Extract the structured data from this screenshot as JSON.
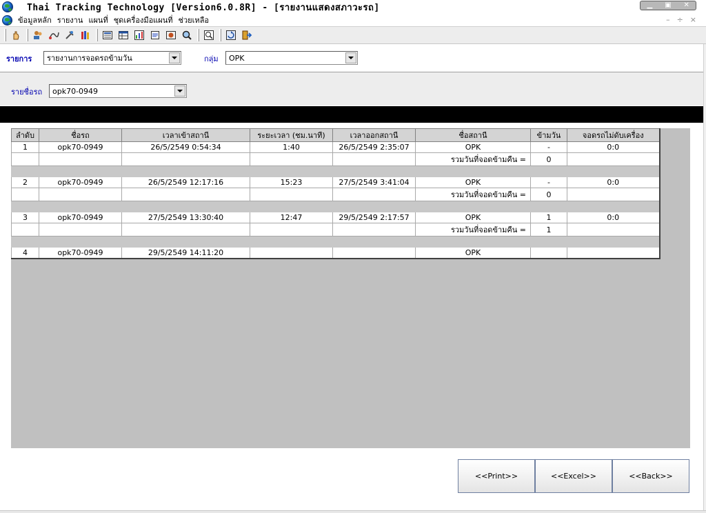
{
  "window": {
    "title": "Thai Tracking Technology [Version6.0.8R] - [รายงานแสดงสภาวะรถ]",
    "controls": [
      "▁",
      "▣",
      "✕"
    ]
  },
  "menu": {
    "items": [
      "ข้อมูลหลัก",
      "รายงาน",
      "แผนที่",
      "ชุดเครื่องมือแผนที่",
      "ช่วยเหลือ"
    ],
    "mdi_controls": [
      "–",
      "÷",
      "×"
    ]
  },
  "toolbar": {
    "icons": [
      "hand-icon",
      "users-icon",
      "route-icon",
      "tools-icon",
      "books-icon",
      "report-icon",
      "table-icon",
      "chart-icon",
      "list-icon",
      "photo-icon",
      "search-map-icon",
      "zoom-icon",
      "refresh-icon",
      "exit-icon"
    ]
  },
  "filters": {
    "list_label": "รายการ",
    "list_value": "รายงานการจอดรถข้ามวัน",
    "group_label": "กลุ่ม",
    "group_value": "OPK",
    "vehicle_label": "รายชื่อรถ",
    "vehicle_value": "opk70-0949"
  },
  "table": {
    "headers": [
      "ลำดับ",
      "ชื่อรถ",
      "เวลาเข้าสถานี",
      "ระยะเวลา (ชม.นาที)",
      "เวลาออกสถานี",
      "ชื่อสถานี",
      "ข้ามวัน",
      "จอดรถไม่ดับเครื่อง"
    ],
    "summary_label": "รวมวันที่จอดข้ามคืน =",
    "records": [
      {
        "no": "1",
        "vehicle": "opk70-0949",
        "in": "26/5/2549 0:54:34",
        "duration": "1:40",
        "out": "26/5/2549 2:35:07",
        "station": "OPK",
        "overnight": "-",
        "idle": "0:0",
        "total": "0"
      },
      {
        "no": "2",
        "vehicle": "opk70-0949",
        "in": "26/5/2549 12:17:16",
        "duration": "15:23",
        "out": "27/5/2549 3:41:04",
        "station": "OPK",
        "overnight": "-",
        "idle": "0:0",
        "total": "0"
      },
      {
        "no": "3",
        "vehicle": "opk70-0949",
        "in": "27/5/2549 13:30:40",
        "duration": "12:47",
        "out": "29/5/2549 2:17:57",
        "station": "OPK",
        "overnight": "1",
        "idle": "0:0",
        "total": "1"
      },
      {
        "no": "4",
        "vehicle": "opk70-0949",
        "in": "29/5/2549 14:11:20",
        "duration": "",
        "out": "",
        "station": "OPK",
        "overnight": "",
        "idle": "",
        "total": null
      }
    ]
  },
  "buttons": {
    "print": "<<Print>>",
    "excel": "<<Excel>>",
    "back": "<<Back>>"
  }
}
